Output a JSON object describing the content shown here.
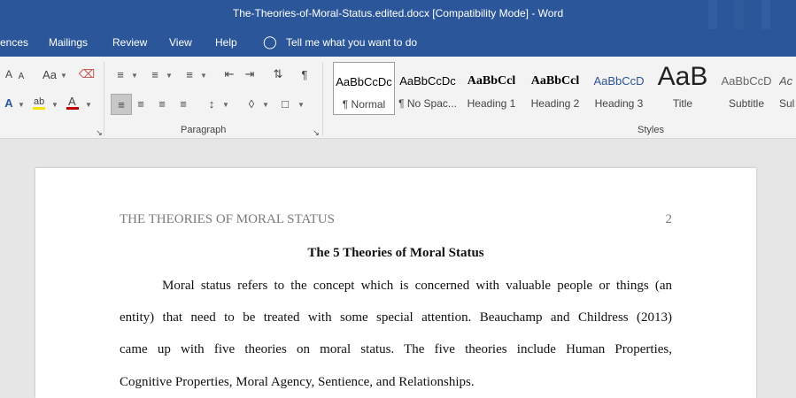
{
  "titlebar": {
    "title": "The-Theories-of-Moral-Status.edited.docx [Compatibility Mode]  -  Word"
  },
  "tabs": {
    "references": "ences",
    "mailings": "Mailings",
    "review": "Review",
    "view": "View",
    "help": "Help",
    "tell_me": "Tell me what you want to do"
  },
  "ribbon": {
    "font_group": {
      "grow": "A",
      "shrink": "A",
      "change_case": "Aa",
      "text_effects": "A",
      "font_color": "A"
    },
    "paragraph_group": {
      "label": "Paragraph",
      "pilcrow": "¶"
    },
    "styles_group": {
      "label": "Styles",
      "items": [
        {
          "sample": "AaBbCcDc",
          "name": "¶ Normal"
        },
        {
          "sample": "AaBbCcDc",
          "name": "¶ No Spac..."
        },
        {
          "sample": "AaBbCcl",
          "name": "Heading 1"
        },
        {
          "sample": "AaBbCcl",
          "name": "Heading 2"
        },
        {
          "sample": "AaBbCcD",
          "name": "Heading 3"
        },
        {
          "sample": "AaB",
          "name": "Title"
        },
        {
          "sample": "AaBbCcD",
          "name": "Subtitle"
        },
        {
          "sample": "Ac",
          "name": "Sul"
        }
      ]
    }
  },
  "document": {
    "running_head": "THE THEORIES OF MORAL STATUS",
    "page_number": "2",
    "title": "The 5 Theories of Moral Status",
    "lines": [
      "Moral status refers to the concept which is concerned with valuable people or things (an",
      "entity) that need to be treated with some special attention. Beauchamp and Childress (2013)",
      "came up with five theories on moral status. The five theories include Human Properties,",
      "Cognitive Properties, Moral Agency, Sentience, and Relationships."
    ]
  }
}
